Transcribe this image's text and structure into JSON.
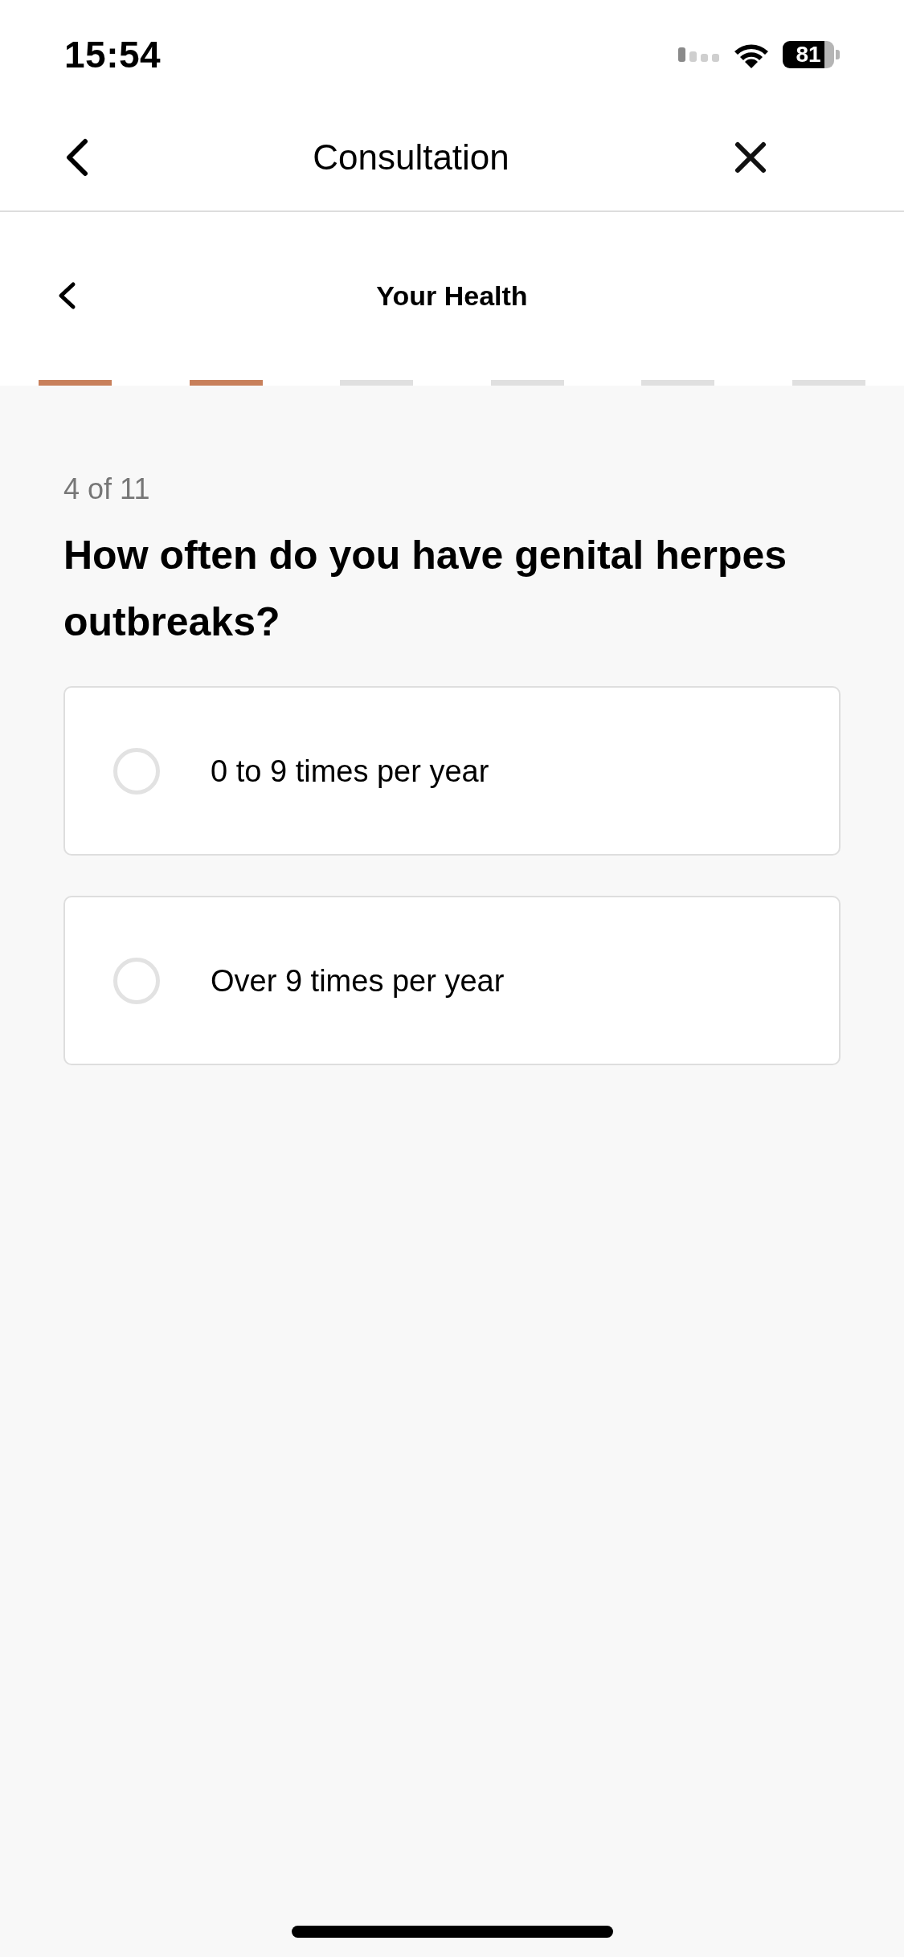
{
  "status_bar": {
    "time": "15:54",
    "battery": "81"
  },
  "nav_bar": {
    "title": "Consultation"
  },
  "section_header": {
    "title": "Your Health"
  },
  "progress_steps": [
    {
      "filled": true
    },
    {
      "filled": true
    },
    {
      "filled": false
    },
    {
      "filled": false
    },
    {
      "filled": false
    },
    {
      "filled": false
    }
  ],
  "question": {
    "counter": "4 of 11",
    "text": "How often do you have genital herpes outbreaks?"
  },
  "options": [
    {
      "label": "0 to 9 times per year",
      "selected": false
    },
    {
      "label": "Over 9 times per year",
      "selected": false
    }
  ]
}
